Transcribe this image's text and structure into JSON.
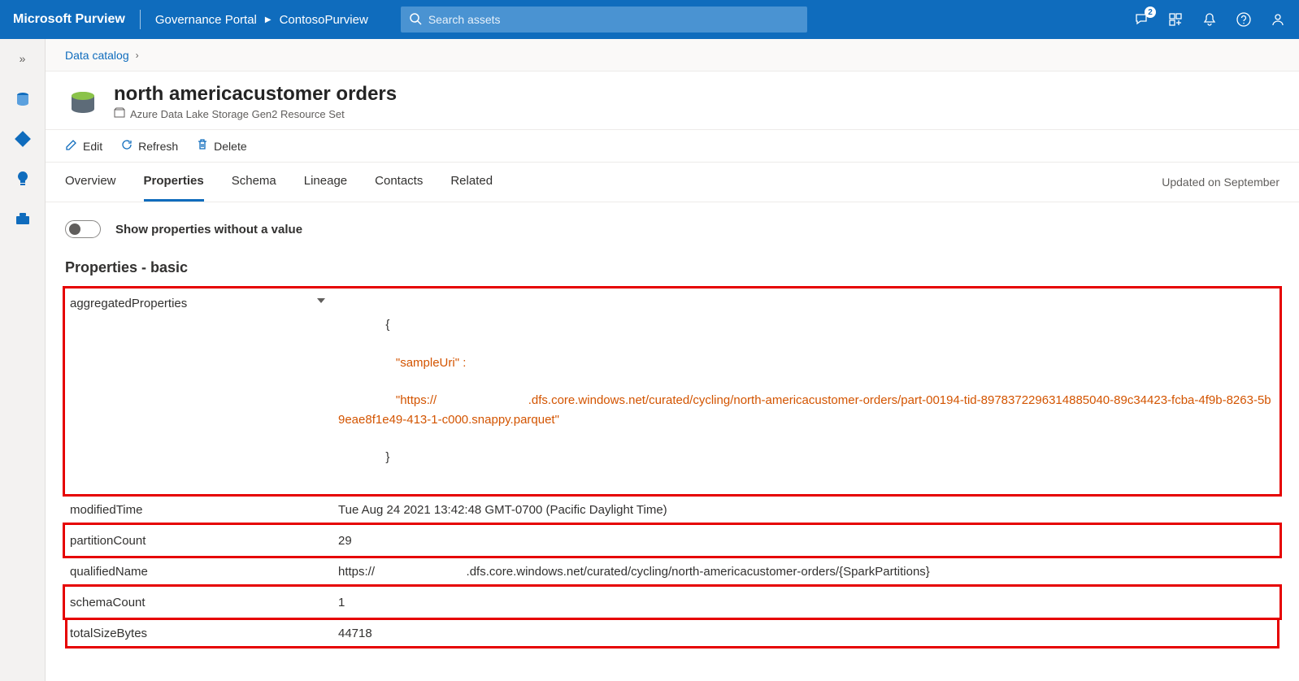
{
  "header": {
    "brand": "Microsoft Purview",
    "portal": "Governance Portal",
    "account": "ContosoPurview",
    "search_placeholder": "Search assets",
    "feedback_badge": "2"
  },
  "breadcrumb": {
    "root": "Data catalog"
  },
  "asset": {
    "title": "north americacustomer orders",
    "subtype": "Azure Data Lake Storage Gen2 Resource Set"
  },
  "actions": {
    "edit": "Edit",
    "refresh": "Refresh",
    "delete": "Delete"
  },
  "tabs": {
    "overview": "Overview",
    "properties": "Properties",
    "schema": "Schema",
    "lineage": "Lineage",
    "contacts": "Contacts",
    "related": "Related",
    "active": "properties",
    "updated": "Updated on September"
  },
  "toggle": {
    "label": "Show properties without a value"
  },
  "section_title": "Properties - basic",
  "properties": {
    "aggregatedProperties": {
      "label": "aggregatedProperties",
      "json_opening": "{",
      "json_key": "\"sampleUri\" :",
      "json_value": "\"https://                           .dfs.core.windows.net/curated/cycling/north-americacustomer-orders/part-00194-tid-8978372296314885040-89c34423-fcba-4f9b-8263-5b9eae8f1e49-413-1-c000.snappy.parquet\"",
      "json_closing": "}"
    },
    "modifiedTime": {
      "label": "modifiedTime",
      "value": "Tue Aug 24 2021 13:42:48 GMT-0700 (Pacific Daylight Time)"
    },
    "partitionCount": {
      "label": "partitionCount",
      "value": "29"
    },
    "qualifiedName": {
      "label": "qualifiedName",
      "value": "https://                           .dfs.core.windows.net/curated/cycling/north-americacustomer-orders/{SparkPartitions}"
    },
    "schemaCount": {
      "label": "schemaCount",
      "value": "1"
    },
    "totalSizeBytes": {
      "label": "totalSizeBytes",
      "value": "44718"
    }
  }
}
